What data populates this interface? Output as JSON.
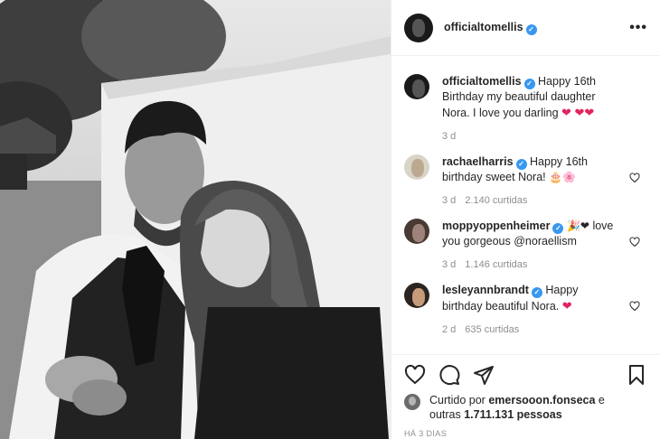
{
  "post": {
    "author": "officialtomellis",
    "more_label": "•••"
  },
  "comments": [
    {
      "user": "officialtomellis",
      "text": "Happy 16th Birthday my beautiful daughter Nora. I love you darling",
      "emojis": "❤ ❤❤",
      "time": "3 d",
      "likes": ""
    },
    {
      "user": "rachaelharris",
      "text": "Happy 16th birthday sweet Nora!",
      "emojis": "🎂🌸",
      "time": "3 d",
      "likes": "2.140 curtidas"
    },
    {
      "user": "moppyoppenheimer",
      "text": "love you gorgeous @noraellism",
      "emojis": "🎉❤",
      "time": "3 d",
      "likes": "1.146 curtidas"
    },
    {
      "user": "lesleyannbrandt",
      "text": "Happy birthday beautiful Nora.",
      "emojis": "❤",
      "time": "2 d",
      "likes": "635 curtidas"
    }
  ],
  "likes": {
    "prefix": "Curtido por",
    "liker": "emersooon.fonseca",
    "connector": "e",
    "others_prefix": "outras",
    "count": "1.711.131",
    "suffix": "pessoas"
  },
  "date": "HÁ 3 DIAS",
  "icons": {
    "like": "heart-icon",
    "comment": "comment-icon",
    "share": "share-icon",
    "save": "bookmark-icon"
  }
}
